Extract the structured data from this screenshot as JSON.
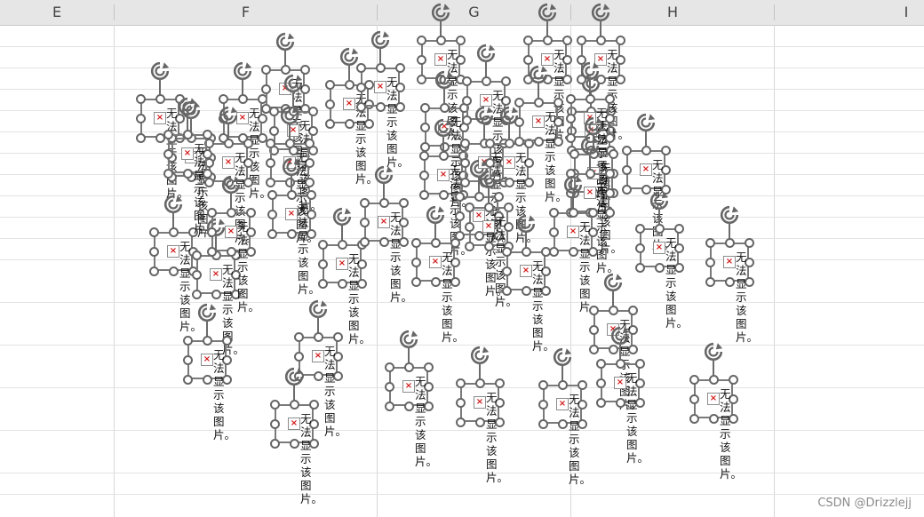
{
  "app": {
    "window_title": ""
  },
  "sheet": {
    "columns": [
      {
        "label": "E"
      },
      {
        "label": "F"
      },
      {
        "label": "G"
      },
      {
        "label": "H"
      },
      {
        "label": "I"
      }
    ]
  },
  "broken_picture": {
    "alt_text": "无法显示该图片。",
    "icon": "broken-image-icon",
    "handle_icon": "rotate-handle-icon",
    "count": 46
  },
  "colors": {
    "missing_image_mark": "#d21a1a",
    "handle_stroke": "#666666",
    "header_bg": "#e6e6e6"
  },
  "watermark": {
    "text": "CSDN @Drizzlejj"
  }
}
